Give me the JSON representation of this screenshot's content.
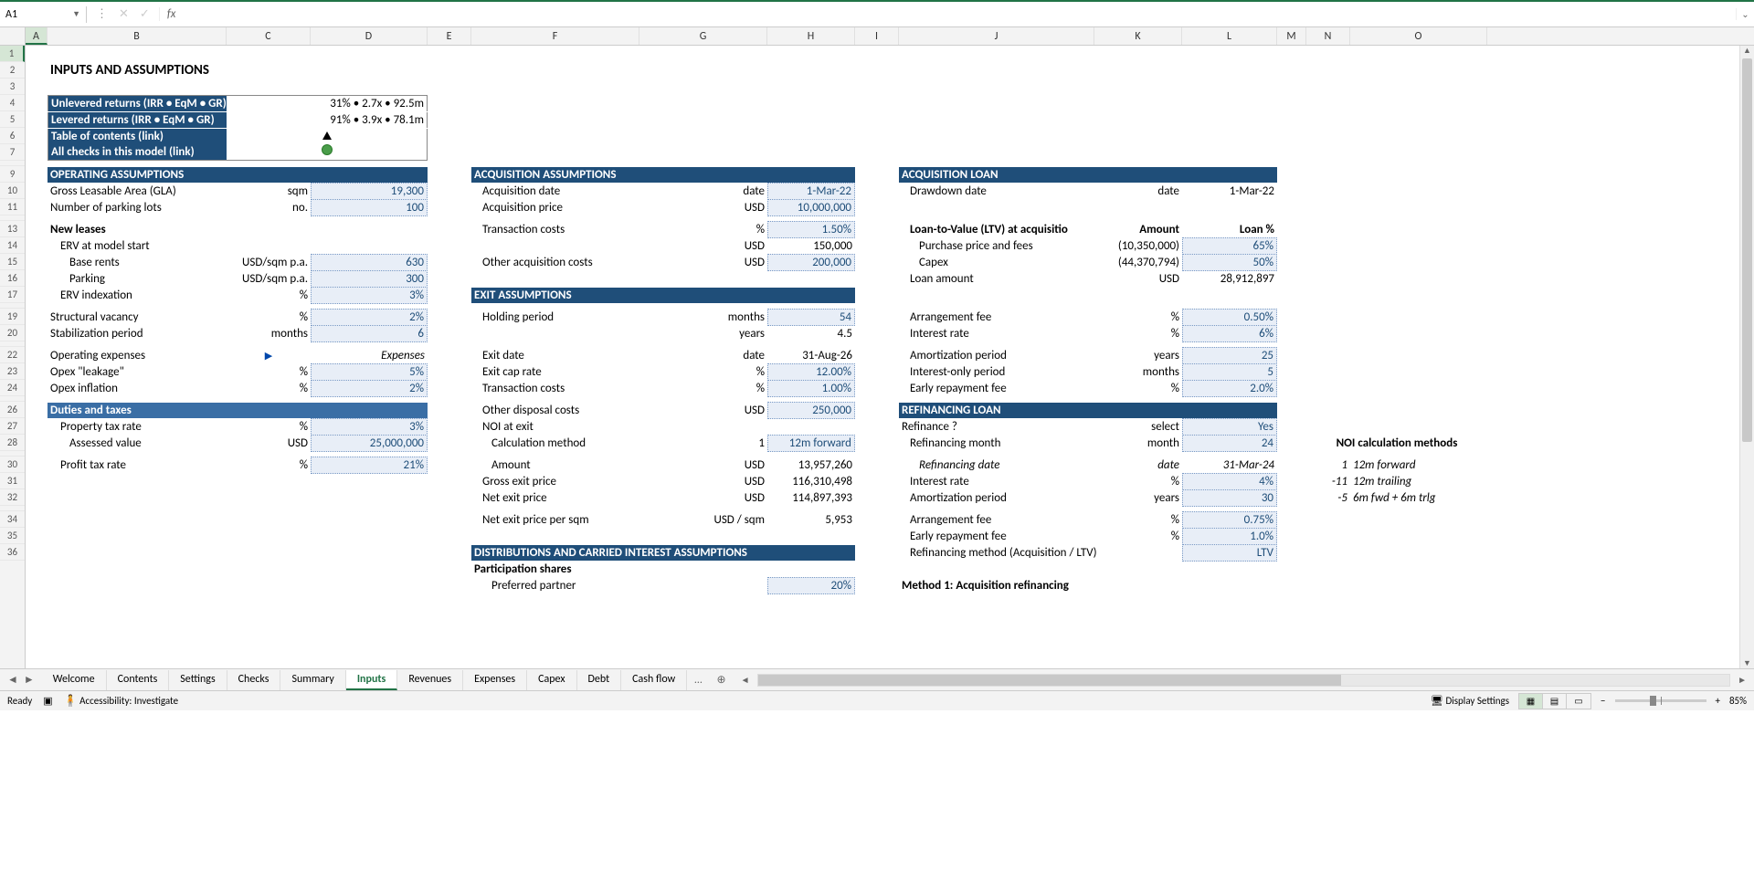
{
  "name_box": "A1",
  "title": "INPUTS AND ASSUMPTIONS",
  "summary": {
    "unlev_label": "Unlevered returns (IRR • EqM • GR)",
    "unlev_value": "31% • 2.7x • 92.5m",
    "lev_label": "Levered returns (IRR • EqM • GR)",
    "lev_value": "91% • 3.9x • 78.1m",
    "toc": "Table of contents (link)",
    "checks": "All checks in this model (link)"
  },
  "sections": {
    "operating": "OPERATING ASSUMPTIONS",
    "acquisition": "ACQUISITION ASSUMPTIONS",
    "acq_loan": "ACQUISITION LOAN",
    "exit": "EXIT ASSUMPTIONS",
    "refi": "REFINANCING LOAN",
    "duties": "Duties and taxes",
    "dist": "DISTRIBUTIONS AND CARRIED INTEREST ASSUMPTIONS",
    "part_shares": "Participation shares",
    "method1": "Method 1: Acquisition refinancing"
  },
  "op": {
    "gla_lbl": "Gross Leasable Area (GLA)",
    "gla_u": "sqm",
    "gla_v": "19,300",
    "park_lbl": "Number of parking lots",
    "park_u": "no.",
    "park_v": "100",
    "new_leases": "New leases",
    "erv_start": "ERV at model start",
    "base_rents": "Base rents",
    "base_rents_u": "USD/sqm p.a.",
    "base_rents_v": "630",
    "parking": "Parking",
    "parking_u": "USD/sqm p.a.",
    "parking_v": "300",
    "erv_idx": "ERV indexation",
    "erv_idx_u": "%",
    "erv_idx_v": "3%",
    "struct_vac": "Structural vacancy",
    "struct_vac_u": "%",
    "struct_vac_v": "2%",
    "stab": "Stabilization period",
    "stab_u": "months",
    "stab_v": "6",
    "opex": "Operating expenses",
    "opex_v": "Expenses",
    "leak": "Opex \"leakage\"",
    "leak_u": "%",
    "leak_v": "5%",
    "infl": "Opex inflation",
    "infl_u": "%",
    "infl_v": "2%"
  },
  "duties": {
    "pt_rate": "Property tax rate",
    "pt_rate_u": "%",
    "pt_rate_v": "3%",
    "assessed": "Assessed value",
    "assessed_u": "USD",
    "assessed_v": "25,000,000",
    "profit": "Profit tax rate",
    "profit_u": "%",
    "profit_v": "21%"
  },
  "acq": {
    "date_lbl": "Acquisition date",
    "date_u": "date",
    "date_v": "1-Mar-22",
    "price_lbl": "Acquisition price",
    "price_u": "USD",
    "price_v": "10,000,000",
    "tc_lbl": "Transaction costs",
    "tc_u": "%",
    "tc_v": "1.50%",
    "tc_usd_u": "USD",
    "tc_usd_v": "150,000",
    "other_lbl": "Other acquisition costs",
    "other_u": "USD",
    "other_v": "200,000"
  },
  "exit": {
    "hold_lbl": "Holding period",
    "hold_u": "months",
    "hold_v": "54",
    "years_u": "years",
    "years_v": "4.5",
    "date_lbl": "Exit date",
    "date_u": "date",
    "date_v": "31-Aug-26",
    "cap_lbl": "Exit cap rate",
    "cap_u": "%",
    "cap_v": "12.00%",
    "tc_lbl": "Transaction costs",
    "tc_u": "%",
    "tc_v": "1.00%",
    "odc_lbl": "Other disposal costs",
    "odc_u": "USD",
    "odc_v": "250,000",
    "noi_lbl": "NOI at exit",
    "calc_lbl": "Calculation method",
    "calc_num": "1",
    "calc_v": "12m forward",
    "amt_lbl": "Amount",
    "amt_u": "USD",
    "amt_v": "13,957,260",
    "gross_lbl": "Gross exit price",
    "gross_u": "USD",
    "gross_v": "116,310,498",
    "net_lbl": "Net exit price",
    "net_u": "USD",
    "net_v": "114,897,393",
    "net_sqm_lbl": "Net exit price per sqm",
    "net_sqm_u": "USD / sqm",
    "net_sqm_v": "5,953"
  },
  "loan": {
    "dd_lbl": "Drawdown date",
    "dd_u": "date",
    "dd_v": "1-Mar-22",
    "ltv_lbl": "Loan-to-Value (LTV) at acquisitio",
    "amt_hdr": "Amount",
    "pct_hdr": "Loan %",
    "pp_lbl": "Purchase price and fees",
    "pp_amt": "(10,350,000)",
    "pp_pct": "65%",
    "capex_lbl": "Capex",
    "capex_amt": "(44,370,794)",
    "capex_pct": "50%",
    "la_lbl": "Loan amount",
    "la_u": "USD",
    "la_v": "28,912,897",
    "arr_lbl": "Arrangement fee",
    "arr_u": "%",
    "arr_v": "0.50%",
    "int_lbl": "Interest rate",
    "int_u": "%",
    "int_v": "6%",
    "amort_lbl": "Amortization period",
    "amort_u": "years",
    "amort_v": "25",
    "io_lbl": "Interest-only period",
    "io_u": "months",
    "io_v": "5",
    "erp_lbl": "Early repayment fee",
    "erp_u": "%",
    "erp_v": "2.0%"
  },
  "refi": {
    "q_lbl": "Refinance ?",
    "q_u": "select",
    "q_v": "Yes",
    "month_lbl": "Refinancing month",
    "month_u": "month",
    "month_v": "24",
    "date_lbl": "Refinancing date",
    "date_u": "date",
    "date_v": "31-Mar-24",
    "int_lbl": "Interest rate",
    "int_u": "%",
    "int_v": "4%",
    "amort_lbl": "Amortization period",
    "amort_u": "years",
    "amort_v": "30",
    "arr_lbl": "Arrangement fee",
    "arr_u": "%",
    "arr_v": "0.75%",
    "erp_lbl": "Early repayment fee",
    "erp_u": "%",
    "erp_v": "1.0%",
    "method_lbl": "Refinancing method (Acquisition / LTV)",
    "method_v": "LTV"
  },
  "noi_methods": {
    "title": "NOI calculation methods",
    "r1n": "1",
    "r1t": "12m forward",
    "r2n": "-11",
    "r2t": "12m trailing",
    "r3n": "-5",
    "r3t": "6m fwd + 6m trlg"
  },
  "dist": {
    "pref_lbl": "Preferred partner",
    "pref_v": "20%"
  },
  "tabs": [
    "Welcome",
    "Contents",
    "Settings",
    "Checks",
    "Summary",
    "Inputs",
    "Revenues",
    "Expenses",
    "Capex",
    "Debt",
    "Cash flow"
  ],
  "active_tab": "Inputs",
  "status": {
    "ready": "Ready",
    "accessibility": "Accessibility: Investigate",
    "display": "Display Settings",
    "zoom": "85%"
  },
  "columns": [
    "A",
    "B",
    "C",
    "D",
    "E",
    "F",
    "G",
    "H",
    "I",
    "J",
    "K",
    "L",
    "M",
    "N",
    "O"
  ]
}
